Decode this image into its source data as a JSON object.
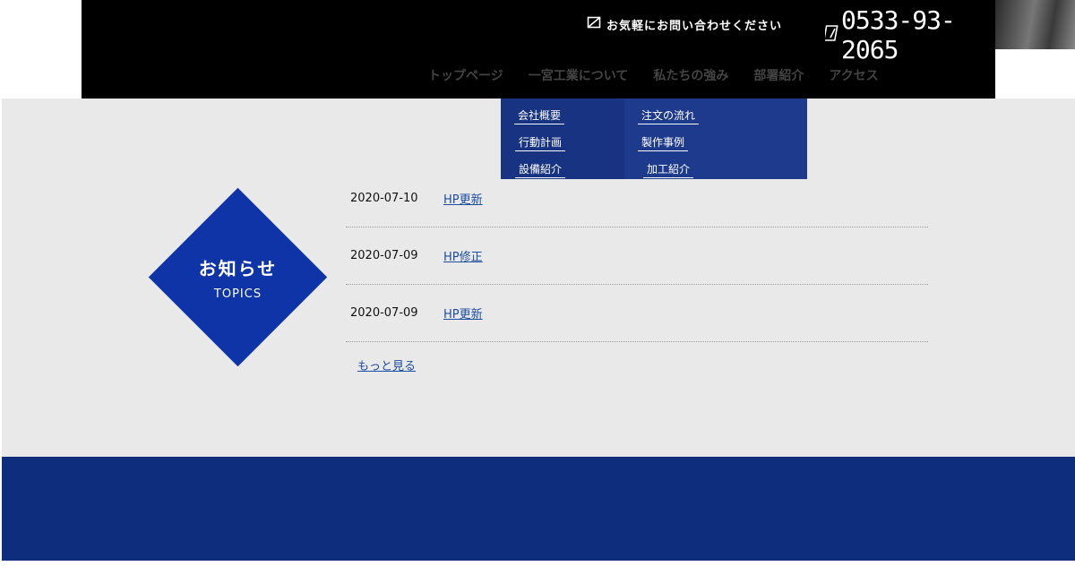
{
  "header": {
    "contact_text": "お気軽にお問い合わせください",
    "phone": "0533-93-2065"
  },
  "nav": {
    "items": [
      {
        "label": "トップページ"
      },
      {
        "label": "一宮工業について"
      },
      {
        "label": "私たちの強み"
      },
      {
        "label": "部署紹介"
      },
      {
        "label": "アクセス"
      }
    ]
  },
  "dropdown": {
    "col1": [
      {
        "label": "会社概要"
      },
      {
        "label": "行動計画"
      },
      {
        "label": "設備紹介"
      }
    ],
    "col2": [
      {
        "label": "注文の流れ"
      },
      {
        "label": "製作事例"
      },
      {
        "label": "加工紹介"
      }
    ]
  },
  "topics": {
    "title_jp": "お知らせ",
    "title_en": "TOPICS"
  },
  "news": [
    {
      "date": "2020-07-10",
      "title": "HP更新"
    },
    {
      "date": "2020-07-09",
      "title": "HP修正"
    },
    {
      "date": "2020-07-09",
      "title": "HP更新"
    }
  ],
  "more_label": "もっと見る",
  "colors": {
    "header_bg": "#000000",
    "main_bg": "#e9e9e9",
    "footer_bg": "#0e2d7c",
    "topics_diamond": "#0e34a7",
    "dropdown_bg": "#1e3a8c",
    "link": "#1c4ea0"
  },
  "icons": {
    "contact": "mail-icon",
    "phone": "phone-icon"
  }
}
